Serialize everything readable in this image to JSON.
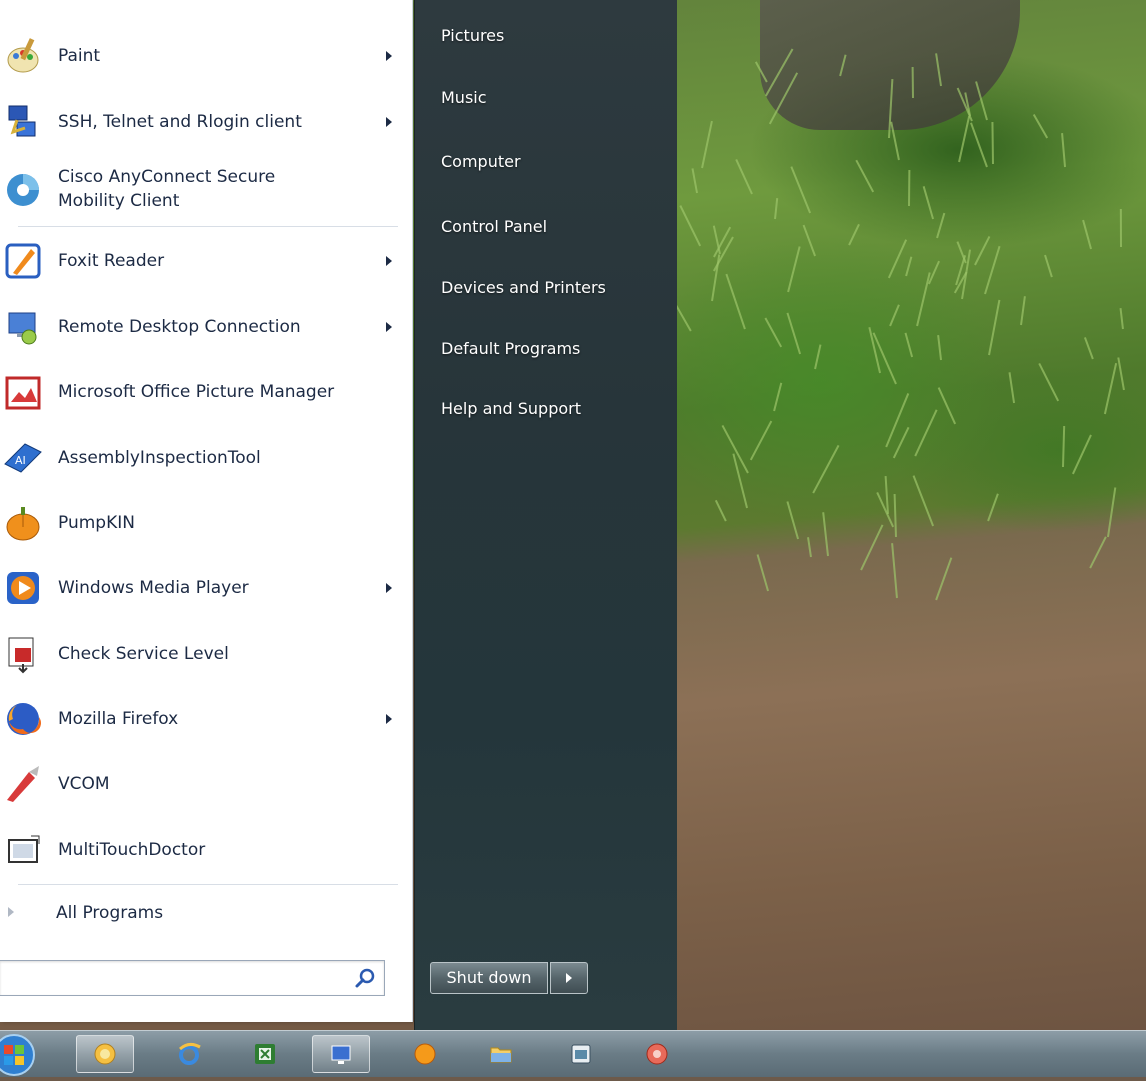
{
  "start_menu": {
    "programs": [
      {
        "label": "Paint",
        "has_submenu": true,
        "icon": "paint-icon"
      },
      {
        "label": "SSH, Telnet and Rlogin client",
        "has_submenu": true,
        "icon": "network-client-icon"
      },
      {
        "label": "Cisco AnyConnect Secure",
        "label2": "Mobility Client",
        "has_submenu": false,
        "icon": "cisco-anyconnect-icon"
      },
      {
        "label": "Foxit Reader",
        "has_submenu": true,
        "icon": "foxit-reader-icon"
      },
      {
        "label": "Remote Desktop Connection",
        "has_submenu": true,
        "icon": "remote-desktop-icon"
      },
      {
        "label": "Microsoft Office Picture Manager",
        "has_submenu": false,
        "icon": "picture-manager-icon"
      },
      {
        "label": "AssemblyInspectionTool",
        "has_submenu": false,
        "icon": "assembly-tool-icon"
      },
      {
        "label": "PumpKIN",
        "has_submenu": false,
        "icon": "pumpkin-icon"
      },
      {
        "label": "Windows Media Player",
        "has_submenu": true,
        "icon": "media-player-icon"
      },
      {
        "label": "Check Service Level",
        "has_submenu": false,
        "icon": "service-level-icon"
      },
      {
        "label": "Mozilla Firefox",
        "has_submenu": true,
        "icon": "firefox-icon"
      },
      {
        "label": "VCOM",
        "has_submenu": false,
        "icon": "vcom-icon"
      },
      {
        "label": "MultiTouchDoctor",
        "has_submenu": false,
        "icon": "multitouch-icon"
      }
    ],
    "all_programs_label": "All Programs",
    "search": {
      "value": "",
      "placeholder": ""
    },
    "right_items": [
      {
        "label": "Pictures"
      },
      {
        "label": "Music"
      },
      {
        "label": "Computer"
      },
      {
        "label": "Control Panel"
      },
      {
        "label": "Devices and Printers"
      },
      {
        "label": "Default Programs"
      },
      {
        "label": "Help and Support"
      }
    ],
    "shutdown_label": "Shut down"
  },
  "taskbar": {
    "buttons": [
      {
        "icon": "windows-explorer-icon",
        "active": true
      },
      {
        "icon": "internet-explorer-icon",
        "active": false
      },
      {
        "icon": "excel-icon",
        "active": false
      },
      {
        "icon": "remote-desktop-taskbar-icon",
        "active": true
      },
      {
        "icon": "orange-app-icon",
        "active": false
      },
      {
        "icon": "folder-icon",
        "active": false
      },
      {
        "icon": "app-window-icon",
        "active": false
      },
      {
        "icon": "red-app-icon",
        "active": false
      }
    ]
  },
  "colors": {
    "menu_text": "#1c2a44",
    "right_pane_bg": "#27353a",
    "taskbar_bg": "#6a7c86"
  }
}
